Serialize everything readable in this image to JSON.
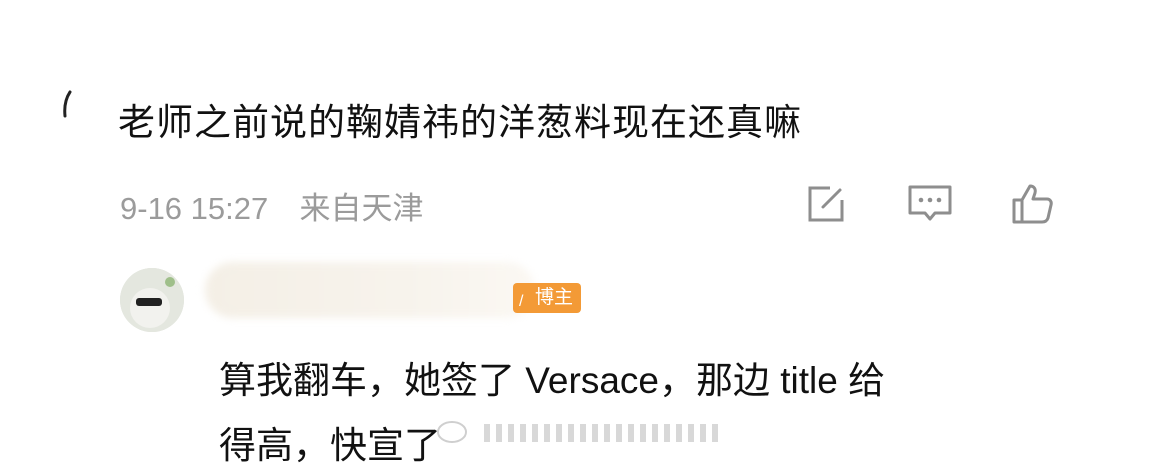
{
  "comment": {
    "text": "老师之前说的鞠婧祎的洋葱料现在还真嘛",
    "time": "9-16 15:27",
    "location": "来自天津"
  },
  "actions": {
    "repost_icon": "edit-square-icon",
    "reply_icon": "comment-bubble-icon",
    "like_icon": "thumbs-up-icon"
  },
  "reply": {
    "badge": "博主",
    "line1": "算我翻车，她签了 Versace，那边 title 给",
    "line2": "得高，快宣了"
  },
  "colors": {
    "text": "#111111",
    "meta": "#9b9b9b",
    "badge": "#f39a36"
  }
}
